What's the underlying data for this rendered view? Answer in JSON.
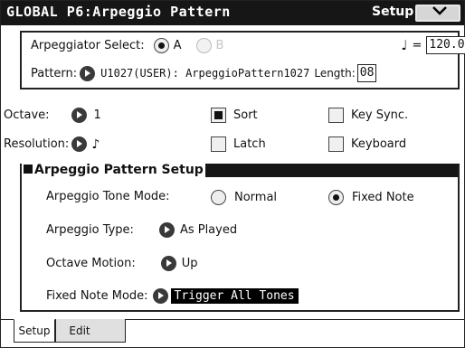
{
  "title_bar": {
    "title": "GLOBAL  P6:Arpeggio Pattern",
    "page_label": "Setup",
    "menu_glyph": "∨"
  },
  "arpeggiator": {
    "select_label": "Arpeggiator Select:",
    "option_a": "A",
    "option_b": "B",
    "selected": "A",
    "tempo_glyph": "♩",
    "tempo_equals": "=",
    "tempo_value": "120.00"
  },
  "pattern": {
    "label": "Pattern:",
    "value": "U1027(USER): ArpeggioPattern1027",
    "length_label": "Length:",
    "length_value": "08"
  },
  "settings": {
    "octave_label": "Octave:",
    "octave_value": "1",
    "resolution_label": "Resolution:",
    "resolution_value": "♪",
    "sort_label": "Sort",
    "sort_checked": true,
    "latch_label": "Latch",
    "latch_checked": false,
    "key_sync_label": "Key Sync.",
    "key_sync_checked": false,
    "keyboard_label": "Keyboard",
    "keyboard_checked": false
  },
  "setup_section": {
    "title": "Arpeggio Pattern Setup",
    "tone_mode_label": "Arpeggio Tone Mode:",
    "tone_mode_normal": "Normal",
    "tone_mode_fixed": "Fixed Note",
    "tone_mode_selected": "Fixed Note",
    "type_label": "Arpeggio Type:",
    "type_value": "As Played",
    "octave_motion_label": "Octave Motion:",
    "octave_motion_value": "Up",
    "fixed_note_mode_label": "Fixed Note Mode:",
    "fixed_note_mode_value": "Trigger All Tones"
  },
  "tabs": [
    {
      "label": "Setup",
      "active": true
    },
    {
      "label": "Edit",
      "active": false
    }
  ]
}
